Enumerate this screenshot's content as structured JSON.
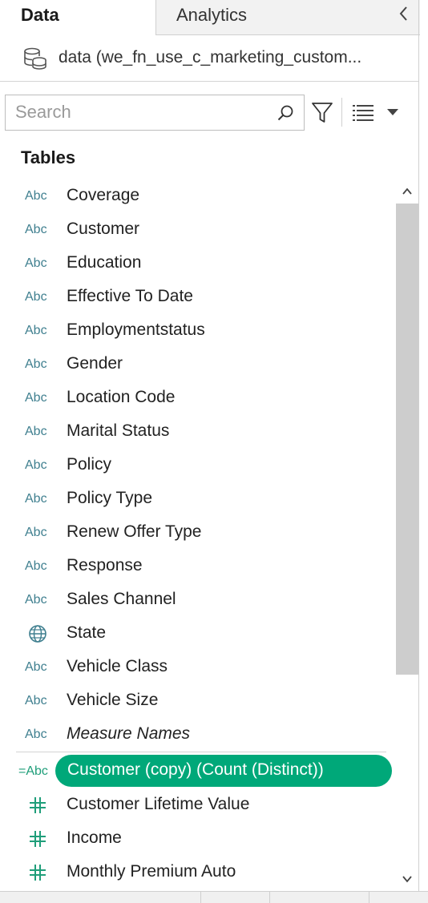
{
  "tabs": {
    "data_label": "Data",
    "analytics_label": "Analytics"
  },
  "datasource": {
    "name": "data (we_fn_use_c_marketing_custom..."
  },
  "search": {
    "placeholder": "Search"
  },
  "tables_heading": "Tables",
  "fields": [
    {
      "type": "Abc",
      "name": "Coverage"
    },
    {
      "type": "Abc",
      "name": "Customer"
    },
    {
      "type": "Abc",
      "name": "Education"
    },
    {
      "type": "Abc",
      "name": "Effective To Date"
    },
    {
      "type": "Abc",
      "name": "Employmentstatus"
    },
    {
      "type": "Abc",
      "name": "Gender"
    },
    {
      "type": "Abc",
      "name": "Location Code"
    },
    {
      "type": "Abc",
      "name": "Marital Status"
    },
    {
      "type": "Abc",
      "name": "Policy"
    },
    {
      "type": "Abc",
      "name": "Policy Type"
    },
    {
      "type": "Abc",
      "name": "Renew Offer Type"
    },
    {
      "type": "Abc",
      "name": "Response"
    },
    {
      "type": "Abc",
      "name": "Sales Channel"
    },
    {
      "type": "globe-icon",
      "name": "State"
    },
    {
      "type": "Abc",
      "name": "Vehicle Class"
    },
    {
      "type": "Abc",
      "name": "Vehicle Size"
    },
    {
      "type": "Abc",
      "name": "Measure Names"
    }
  ],
  "selected_field": {
    "type": "=Abc",
    "name": "Customer (copy) (Count (Distinct))"
  },
  "measures": [
    {
      "type": "hash-icon",
      "name": "Customer Lifetime Value"
    },
    {
      "type": "hash-icon",
      "name": "Income"
    },
    {
      "type": "hash-icon",
      "name": "Monthly Premium Auto"
    }
  ],
  "colors": {
    "dimension_type": "#3f7f8f",
    "selected_pill": "#00a879",
    "measure_icon": "#1f9e7a"
  }
}
